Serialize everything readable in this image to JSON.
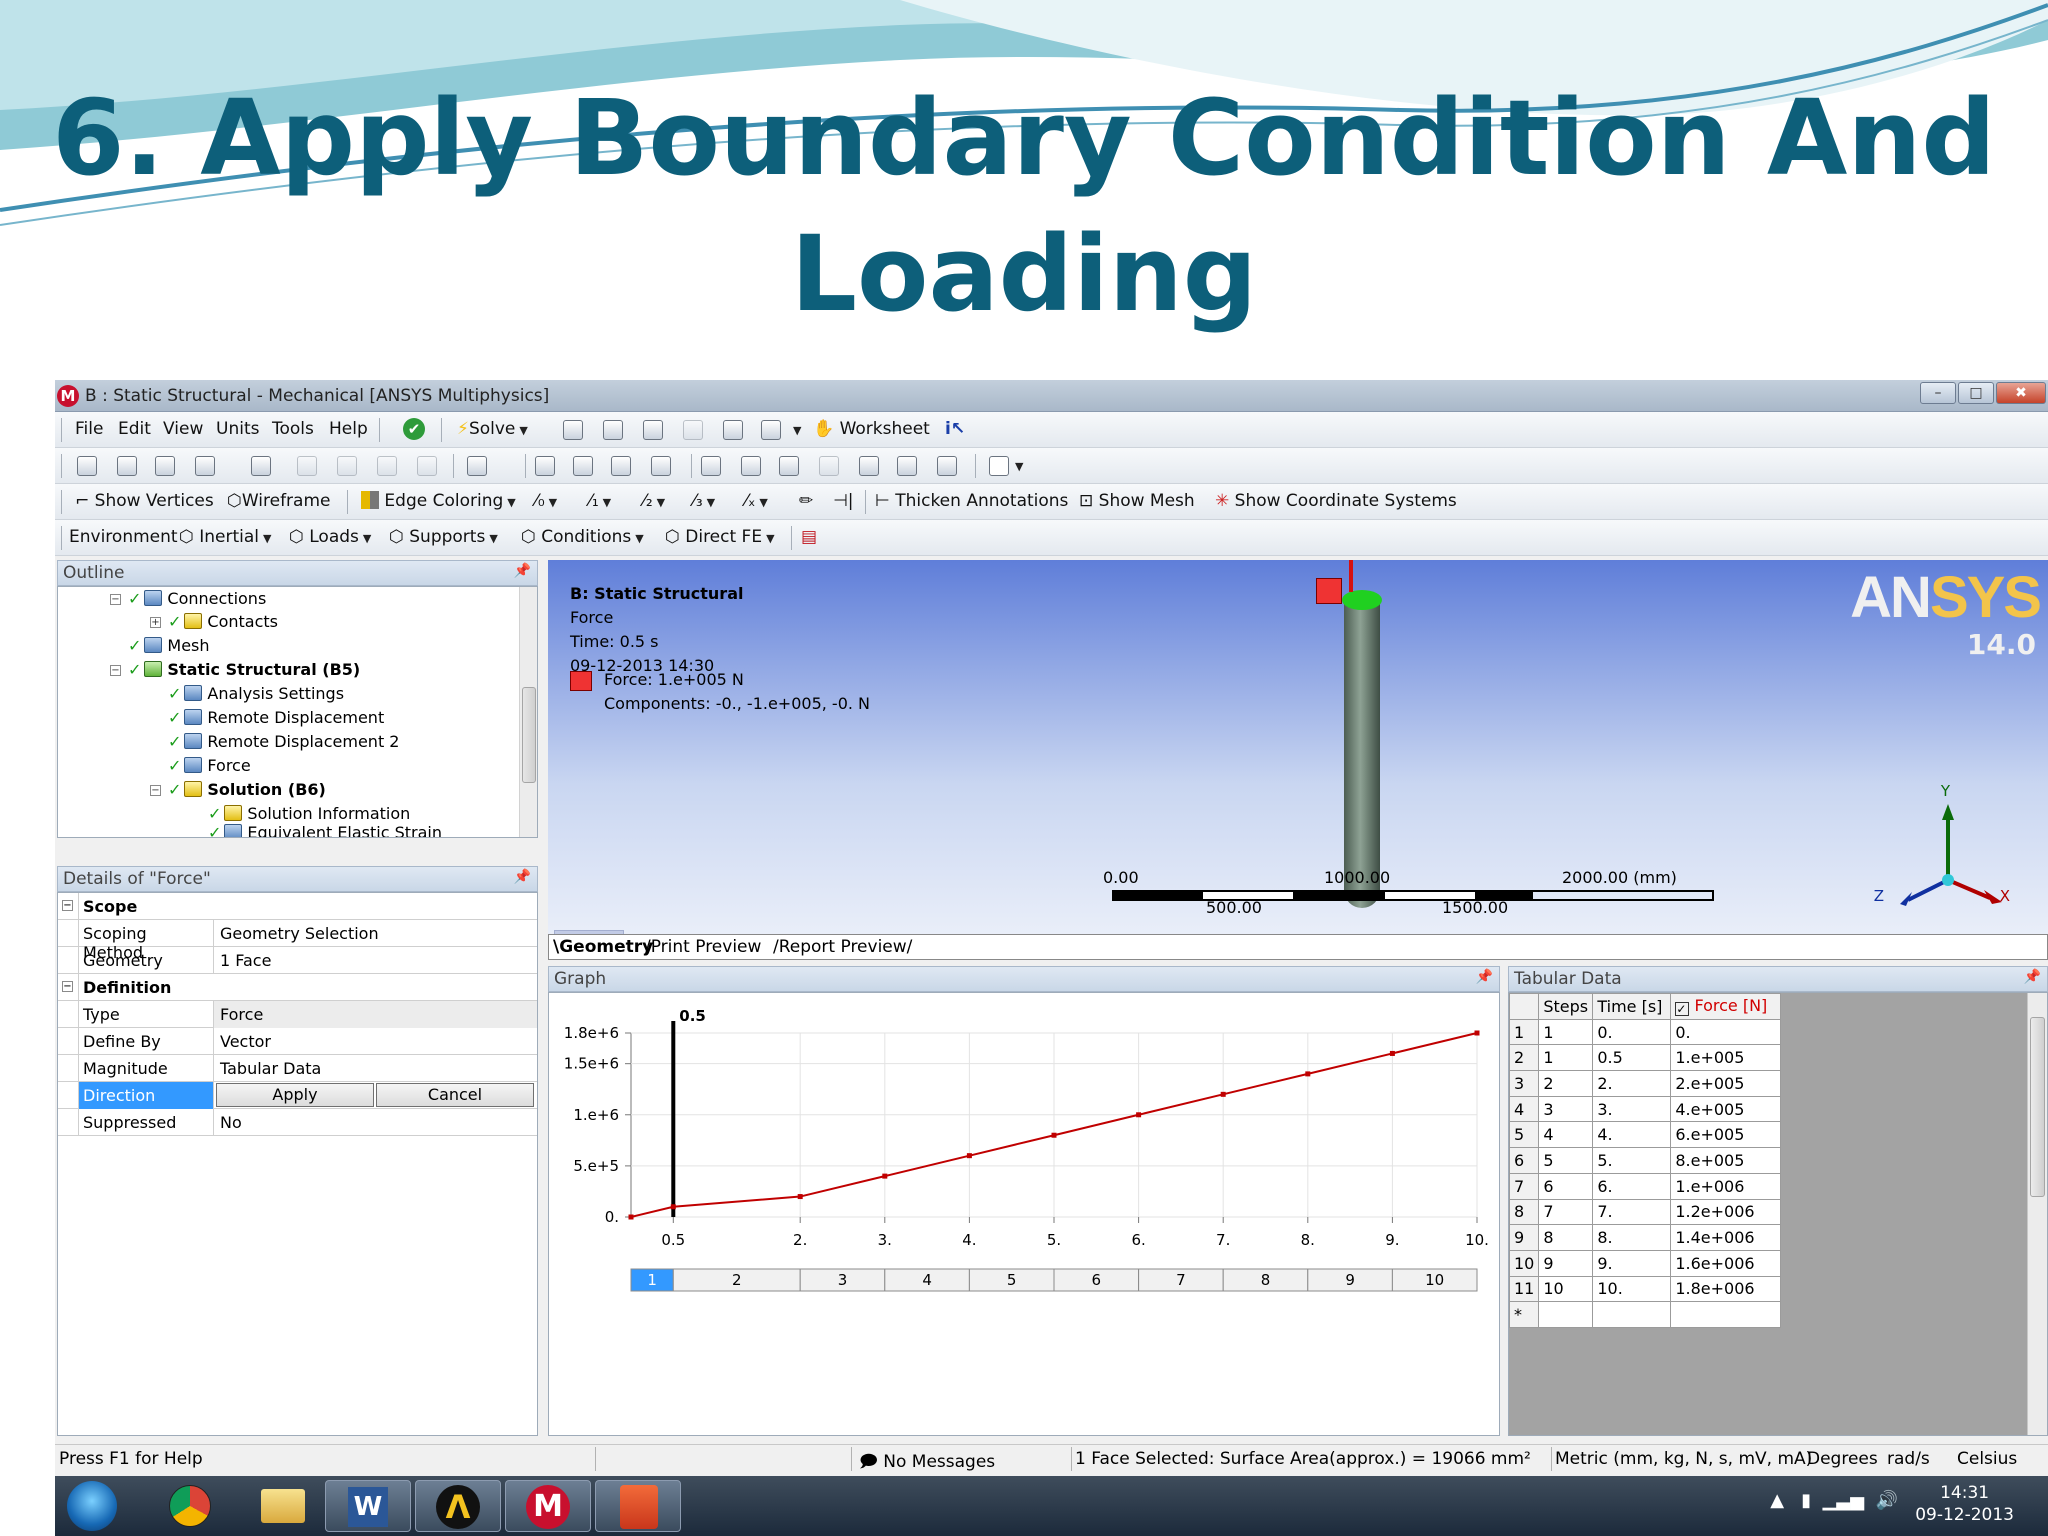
{
  "slide": {
    "title_line1": "6. Apply Boundary Condition And",
    "title_line2": "Loading"
  },
  "window": {
    "title": "B : Static Structural - Mechanical [ANSYS Multiphysics]",
    "app_icon": "M",
    "min": "–",
    "max": "□",
    "close": "✖"
  },
  "menu": {
    "items": [
      "File",
      "Edit",
      "View",
      "Units",
      "Tools",
      "Help"
    ],
    "solve": "Solve",
    "worksheet": "Worksheet"
  },
  "toolbar3": {
    "show_vertices": "Show Vertices",
    "wireframe": "Wireframe",
    "edge_coloring": "Edge Coloring",
    "thicken": "Thicken Annotations",
    "show_mesh": "Show Mesh",
    "show_cs": "Show Coordinate Systems"
  },
  "toolbar4": {
    "environment": "Environment",
    "inertial": "Inertial",
    "loads": "Loads",
    "supports": "Supports",
    "conditions": "Conditions",
    "direct_fe": "Direct FE"
  },
  "outline": {
    "header": "Outline",
    "nodes": [
      "Connections",
      "Contacts",
      "Mesh",
      "Static Structural (B5)",
      "Analysis Settings",
      "Remote Displacement",
      "Remote Displacement 2",
      "Force",
      "Solution (B6)",
      "Solution Information",
      "Equivalent Elastic Strain"
    ]
  },
  "details": {
    "header": "Details of \"Force\"",
    "scope": "Scope",
    "scoping_method_k": "Scoping Method",
    "scoping_method_v": "Geometry Selection",
    "geometry_k": "Geometry",
    "geometry_v": "1 Face",
    "definition": "Definition",
    "type_k": "Type",
    "type_v": "Force",
    "define_by_k": "Define By",
    "define_by_v": "Vector",
    "magnitude_k": "Magnitude",
    "magnitude_v": "Tabular Data",
    "direction_k": "Direction",
    "apply": "Apply",
    "cancel": "Cancel",
    "suppressed_k": "Suppressed",
    "suppressed_v": "No"
  },
  "viewport": {
    "title": "B: Static Structural",
    "subtitle": "Force",
    "time": "Time: 0.5 s",
    "date": "09-12-2013 14:30",
    "force": "Force: 1.e+005 N",
    "components": "Components: -0., -1.e+005, -0. N",
    "logo_a": "AN",
    "logo_b": "SYS",
    "version": "14.0",
    "scale_labels": [
      "0.00",
      "1000.00",
      "2000.00 (mm)",
      "500.00",
      "1500.00"
    ],
    "axis_y": "Y",
    "axis_x": "X",
    "axis_z": "Z",
    "tabs": [
      "Geometry",
      "Print Preview",
      "Report Preview"
    ],
    "colors": {
      "force": "#ef3333",
      "face": "#20d020"
    }
  },
  "graph": {
    "header": "Graph",
    "marker_label": "0.5",
    "steps": [
      "1",
      "2",
      "3",
      "4",
      "5",
      "6",
      "7",
      "8",
      "9",
      "10"
    ]
  },
  "chart_data": {
    "type": "line",
    "x": [
      0,
      0.5,
      2,
      3,
      4,
      5,
      6,
      7,
      8,
      9,
      10
    ],
    "series": [
      {
        "values": [
          0,
          100000,
          200000,
          400000,
          600000,
          800000,
          1000000,
          1200000,
          1400000,
          1600000,
          1800000
        ]
      }
    ],
    "x_tick_labels": [
      "0.5",
      "2.",
      "3.",
      "4.",
      "5.",
      "6.",
      "7.",
      "8.",
      "9.",
      "10."
    ],
    "y_ticks": [
      0,
      500000,
      1000000,
      1500000,
      1800000
    ],
    "y_tick_labels": [
      "0.",
      "5.e+5",
      "1.e+6",
      "1.5e+6",
      "1.8e+6"
    ],
    "xlim": [
      0,
      10
    ],
    "ylim": [
      0,
      1800000
    ],
    "marker_x": 0.5,
    "line_color": "#c00000"
  },
  "tabular": {
    "header": "Tabular Data",
    "columns": [
      "Steps",
      "Time [s]",
      "Force [N]"
    ],
    "rows": [
      [
        "1",
        "1",
        "0.",
        "0."
      ],
      [
        "2",
        "1",
        "0.5",
        "1.e+005"
      ],
      [
        "3",
        "2",
        "2.",
        "2.e+005"
      ],
      [
        "4",
        "3",
        "3.",
        "4.e+005"
      ],
      [
        "5",
        "4",
        "4.",
        "6.e+005"
      ],
      [
        "6",
        "5",
        "5.",
        "8.e+005"
      ],
      [
        "7",
        "6",
        "6.",
        "1.e+006"
      ],
      [
        "8",
        "7",
        "7.",
        "1.2e+006"
      ],
      [
        "9",
        "8",
        "8.",
        "1.4e+006"
      ],
      [
        "10",
        "9",
        "9.",
        "1.6e+006"
      ],
      [
        "11",
        "10",
        "10.",
        "1.8e+006"
      ]
    ],
    "last_row": "*"
  },
  "status": {
    "help": "Press F1 for Help",
    "messages": "No Messages",
    "selection": "1 Face Selected: Surface Area(approx.) = 19066 mm²",
    "units": "Metric (mm, kg, N, s, mV, mA)",
    "degrees": "Degrees",
    "rads": "rad/s",
    "celsius": "Celsius"
  },
  "taskbar": {
    "time": "14:31",
    "date": "09-12-2013",
    "apps": [
      "chrome-icon",
      "folder-icon",
      "word-icon",
      "ansys-workbench-icon",
      "mechanical-icon",
      "pdf-icon"
    ]
  }
}
